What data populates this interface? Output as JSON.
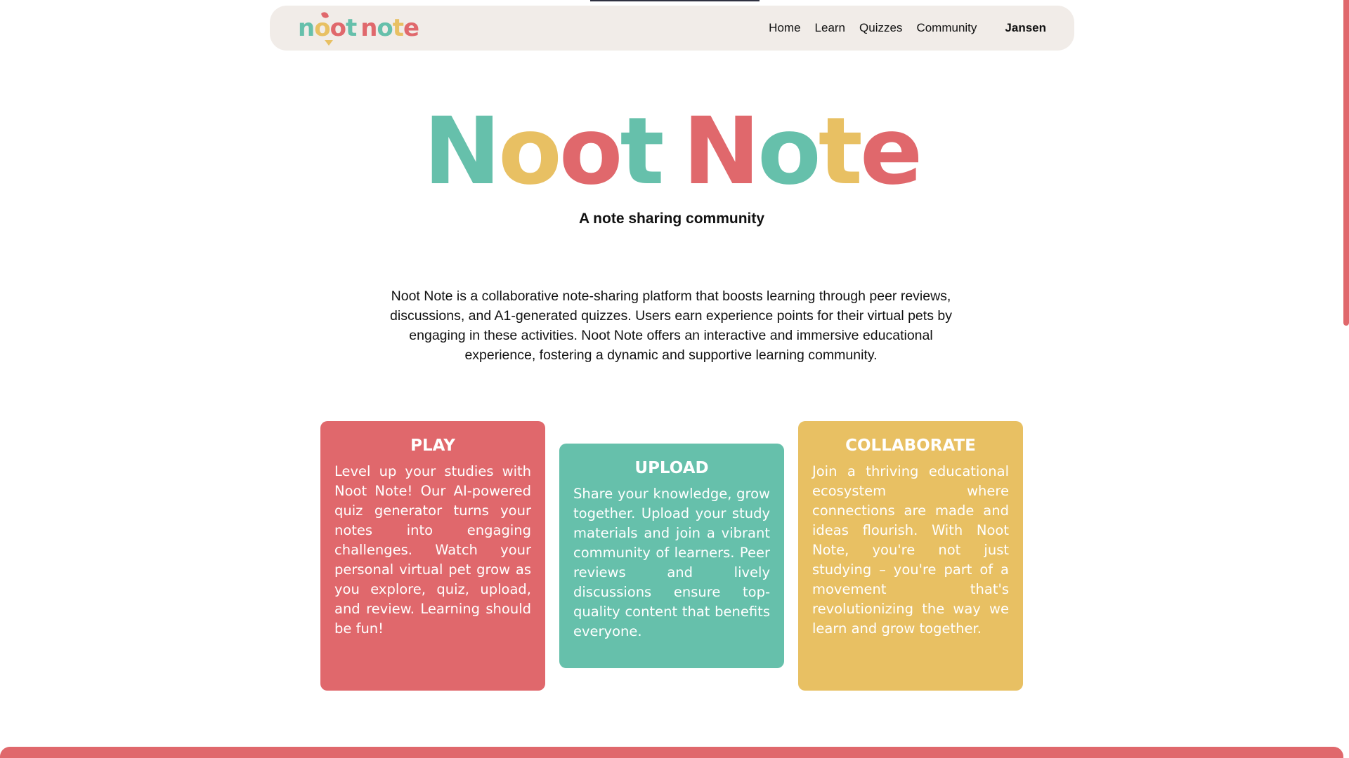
{
  "colors": {
    "teal": "#66c0ab",
    "yellow": "#e8c063",
    "red": "#e0686c",
    "nav_bg": "#f1ece8"
  },
  "logo": {
    "letters": [
      "n",
      "o",
      "o",
      "t",
      " ",
      "n",
      "o",
      "t",
      "e"
    ]
  },
  "nav": {
    "links": [
      "Home",
      "Learn",
      "Quizzes",
      "Community"
    ],
    "user": "Jansen"
  },
  "hero": {
    "title_letters": [
      "N",
      "o",
      "o",
      "t",
      " ",
      "N",
      "o",
      "t",
      "e"
    ],
    "subtitle": "A note sharing community",
    "intro": "Noot Note is a collaborative note-sharing platform that boosts learning through peer reviews, discussions, and A1-generated quizzes. Users earn experience points for their virtual pets by engaging in these activities. Noot Note offers an interactive and immersive educational experience, fostering a dynamic and supportive learning community."
  },
  "cards": {
    "play": {
      "title": "PLAY",
      "body": "Level up your studies with Noot Note! Our AI-powered quiz generator turns your notes into engaging challenges. Watch your personal virtual pet grow as you explore, quiz, upload, and review. Learning should be fun!"
    },
    "upload": {
      "title": "UPLOAD",
      "body": "Share your knowledge, grow together. Upload your study materials and join a vibrant community of learners. Peer reviews and lively discussions ensure top-quality content that benefits everyone."
    },
    "collaborate": {
      "title": "COLLABORATE",
      "body": "Join a thriving educational ecosystem where connections are made and ideas flourish. With Noot Note, you're not just studying – you're part of a movement that's revolutionizing the way we learn and grow together."
    }
  }
}
